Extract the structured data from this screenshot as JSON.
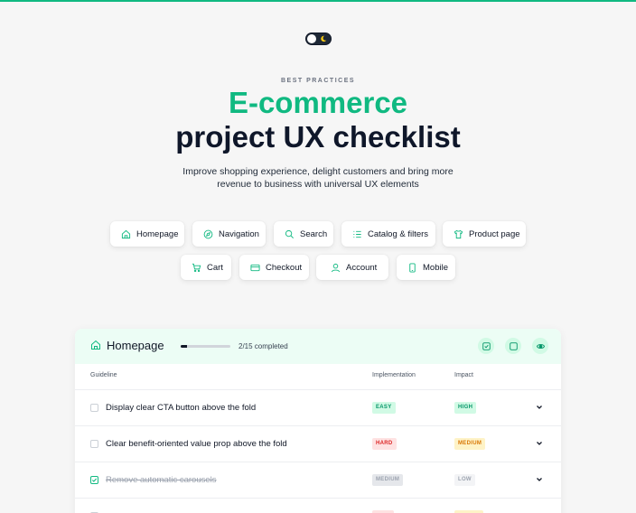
{
  "hero": {
    "eyebrow": "BEST PRACTICES",
    "title_line1": "E-commerce",
    "title_line2": "project UX checklist",
    "subtitle": "Improve shopping experience, delight customers and bring more revenue to business with universal UX elements"
  },
  "categories": [
    {
      "label": "Homepage",
      "icon": "house-icon"
    },
    {
      "label": "Navigation",
      "icon": "compass-icon"
    },
    {
      "label": "Search",
      "icon": "search-icon"
    },
    {
      "label": "Catalog & filters",
      "icon": "list-icon"
    },
    {
      "label": "Product page",
      "icon": "shirt-icon"
    },
    {
      "label": "Cart",
      "icon": "cart-icon"
    },
    {
      "label": "Checkout",
      "icon": "card-icon"
    },
    {
      "label": "Account",
      "icon": "user-icon"
    },
    {
      "label": "Mobile",
      "icon": "phone-icon"
    }
  ],
  "section": {
    "title": "Homepage",
    "progress_completed": 2,
    "progress_total": 15,
    "progress_text": "2/15 completed",
    "actions": [
      "check-all-icon",
      "square-icon",
      "eye-icon"
    ]
  },
  "table": {
    "headers": {
      "guideline": "Guideline",
      "implementation": "Implementation",
      "impact": "Impact"
    },
    "rows": [
      {
        "text": "Display clear CTA button above the fold",
        "checked": false,
        "implementation": "EASY",
        "impact": "HIGH"
      },
      {
        "text": "Clear benefit-oriented value prop above the fold",
        "checked": false,
        "implementation": "HARD",
        "impact": "MEDIUM"
      },
      {
        "text": "Remove automatic carousels",
        "checked": true,
        "implementation": "MEDIUM",
        "impact": "LOW"
      }
    ]
  },
  "colors": {
    "accent": "#10b981",
    "heading": "#0f172a",
    "easy_bg": "#d1fae5",
    "easy_fg": "#059669",
    "hard_bg": "#fee2e2",
    "hard_fg": "#dc2626",
    "medium_bg": "#e5e7eb",
    "medium_fg": "#6b7280",
    "impact_medium_bg": "#fef3c7",
    "impact_medium_fg": "#d97706",
    "low_bg": "#f3f4f6",
    "low_fg": "#9ca3af"
  }
}
